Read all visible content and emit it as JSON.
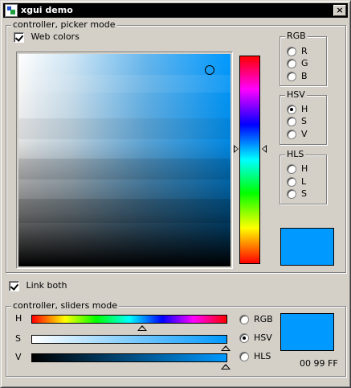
{
  "window": {
    "title": "xgui demo",
    "close_glyph": "×"
  },
  "picker_group": {
    "title": "controller, picker mode",
    "web_colors_label": "Web colors",
    "web_colors_checked": true,
    "selected_hue": 0.55,
    "selected_color": "#0099ff"
  },
  "rgb_group": {
    "title": "RGB",
    "options": [
      "R",
      "G",
      "B"
    ],
    "selected": -1
  },
  "hsv_group": {
    "title": "HSV",
    "options": [
      "H",
      "S",
      "V"
    ],
    "selected": 0
  },
  "hls_group": {
    "title": "HLS",
    "options": [
      "H",
      "L",
      "S"
    ],
    "selected": -1
  },
  "link_both": {
    "label": "Link both",
    "checked": true
  },
  "sliders_group": {
    "title": "controller, sliders mode",
    "sliders": [
      {
        "label": "H",
        "value": 0.58
      },
      {
        "label": "S",
        "value": 1.0
      },
      {
        "label": "V",
        "value": 1.0
      }
    ],
    "modes": [
      "RGB",
      "HSV",
      "HLS"
    ],
    "selected_mode": 1,
    "hex_readout": "00 99 FF",
    "color": "#0099ff"
  }
}
